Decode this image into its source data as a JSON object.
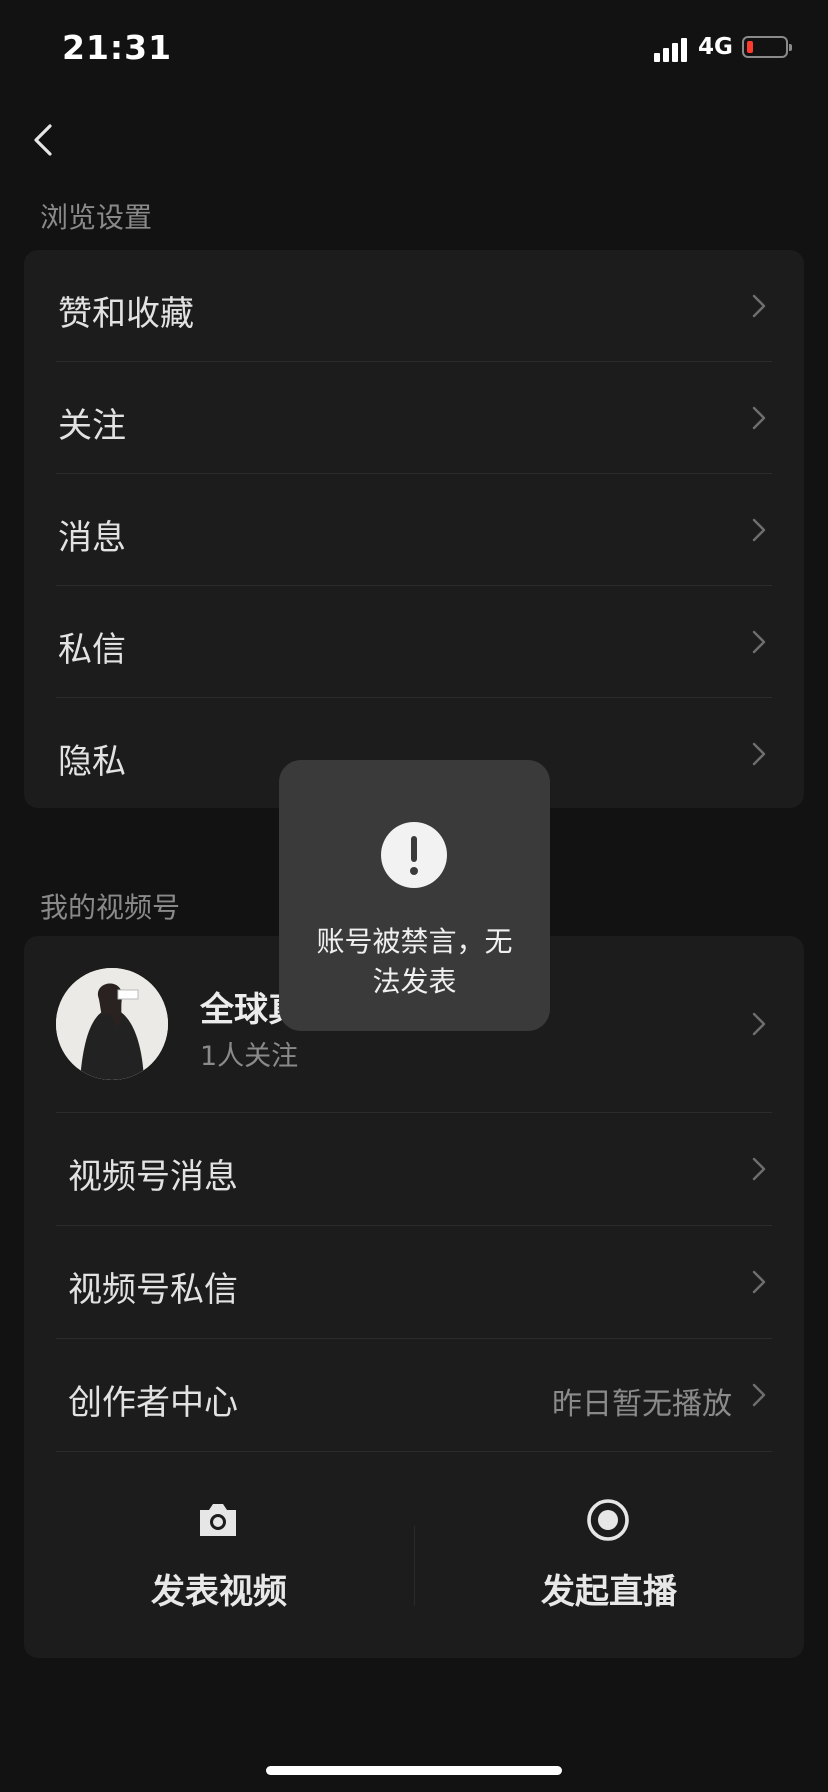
{
  "status_bar": {
    "time": "21:31",
    "network": "4G",
    "battery_color": "#ff3b30"
  },
  "browse_section": {
    "title": "浏览设置",
    "items": [
      {
        "label": "赞和收藏"
      },
      {
        "label": "关注"
      },
      {
        "label": "消息"
      },
      {
        "label": "私信"
      },
      {
        "label": "隐私"
      }
    ]
  },
  "channels_section": {
    "title": "我的视频号",
    "profile": {
      "name": "全球真",
      "followers": "1人关注"
    },
    "items": [
      {
        "label": "视频号消息",
        "value": ""
      },
      {
        "label": "视频号私信",
        "value": ""
      },
      {
        "label": "创作者中心",
        "value": "昨日暂无播放"
      }
    ],
    "actions": [
      {
        "label": "发表视频",
        "icon": "camera-icon"
      },
      {
        "label": "发起直播",
        "icon": "live-record-icon"
      }
    ]
  },
  "toast": {
    "icon": "exclamation-icon",
    "message_line1": "账号被禁言，无",
    "message_line2": "法发表"
  }
}
